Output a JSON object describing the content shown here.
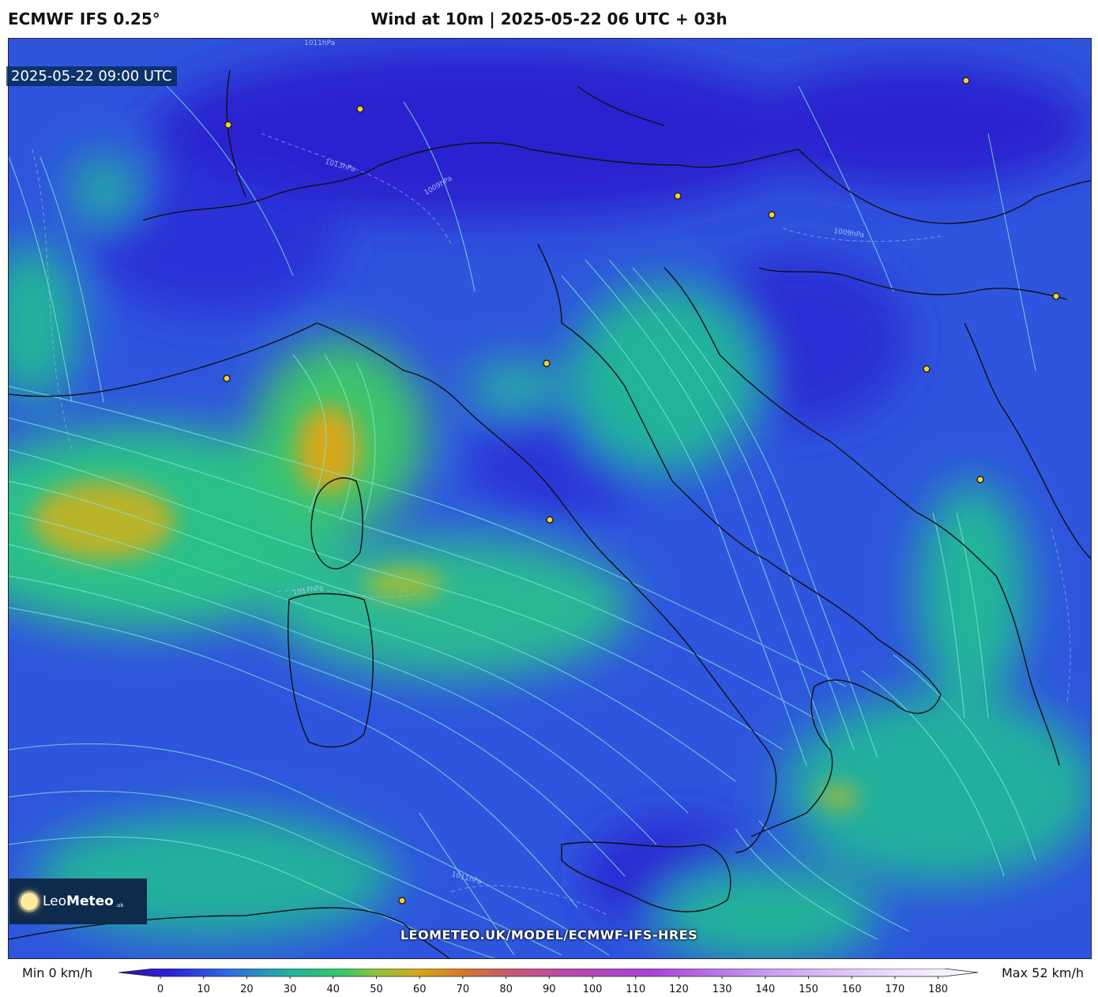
{
  "header": {
    "model": "ECMWF IFS 0.25°",
    "title": "Wind at 10m | 2025-05-22 06 UTC + 03h"
  },
  "map": {
    "valid_time": "2025-05-22 09:00 UTC",
    "isobar_labels": [
      "1011hPa",
      "1013hPa",
      "1009hPa",
      "1009hPa",
      "1011hPa",
      "1017hPa"
    ],
    "city_marker_color": "#f3d23a"
  },
  "branding": {
    "logo_name": "Leo",
    "logo_name_bold": "Meteo",
    "logo_suffix": ".uk",
    "url": "LEOMETEO.UK/MODEL/ECMWF-IFS-HRES"
  },
  "legend": {
    "min_label": "Min 0 km/h",
    "max_label": "Max 52 km/h",
    "ticks": [
      "0",
      "10",
      "20",
      "30",
      "40",
      "50",
      "60",
      "70",
      "80",
      "90",
      "100",
      "110",
      "120",
      "130",
      "140",
      "150",
      "160",
      "170",
      "180"
    ],
    "colors": {
      "calm": "#2a1fd6",
      "low": "#2f6de0",
      "mid": "#21b49a",
      "high": "#35c86a",
      "peak": "#d6a71a",
      "strong": "#c95a6a",
      "very_strong": "#a842d8",
      "extreme": "#f2e6ff"
    }
  }
}
